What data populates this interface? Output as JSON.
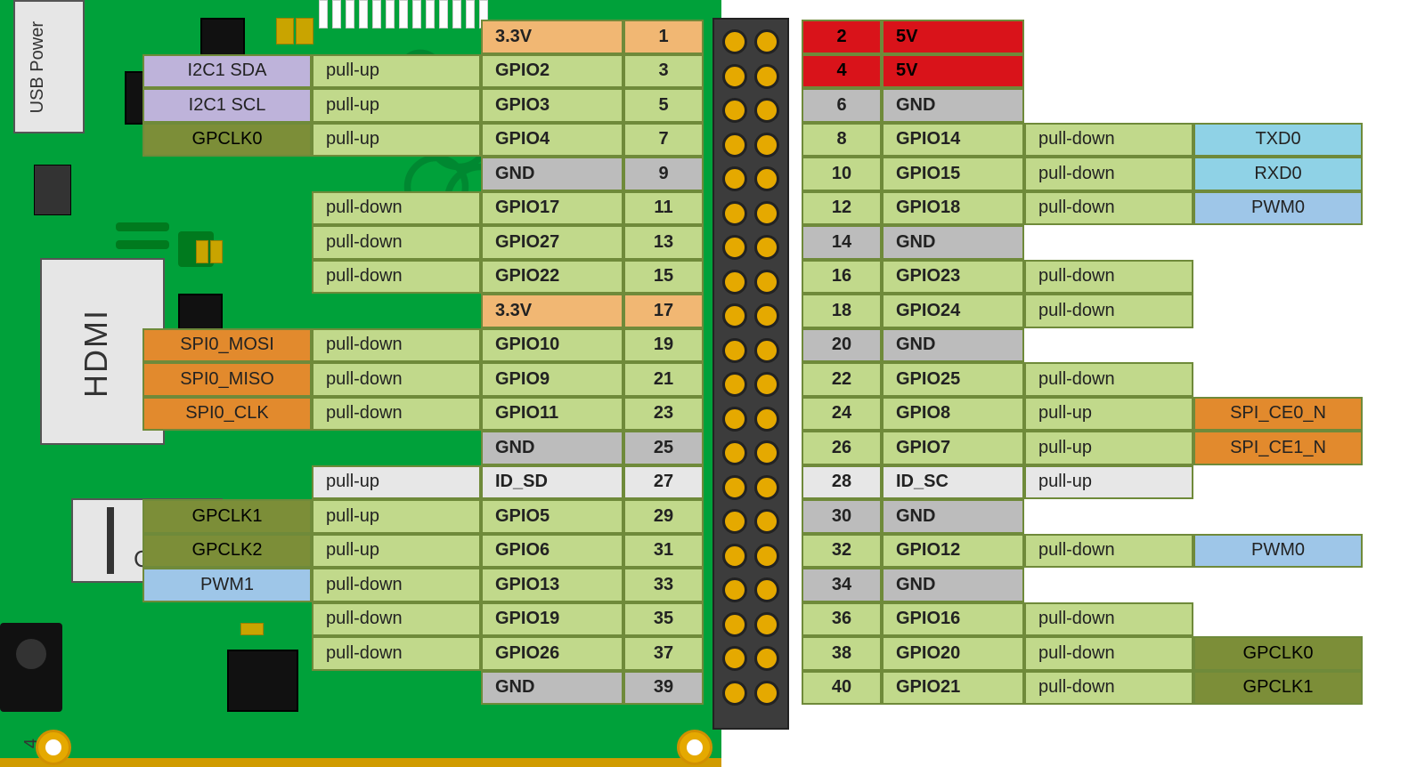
{
  "board": {
    "ports": {
      "usb_power": "USB\nPower",
      "hdmi": "HDMI",
      "camera": "Came"
    },
    "corner_number": "4"
  },
  "colors": {
    "gpio": "#c1d98b",
    "3v3": "#f1b773",
    "5v": "#d9131a",
    "gnd": "#bcbcbc",
    "id": "#e7e7e7",
    "pwm": "#9ec6e8",
    "uart": "#8fd2e6",
    "spi": "#e28a2d",
    "i2c": "#beb3da",
    "clk": "#7c8e38"
  },
  "pins": {
    "left": [
      {
        "num": "1",
        "name": "3.3V",
        "type": "3v3"
      },
      {
        "num": "3",
        "name": "GPIO2",
        "type": "gpio",
        "pull": "pull-up",
        "alt": "I2C1 SDA",
        "altType": "i2c"
      },
      {
        "num": "5",
        "name": "GPIO3",
        "type": "gpio",
        "pull": "pull-up",
        "alt": "I2C1 SCL",
        "altType": "i2c"
      },
      {
        "num": "7",
        "name": "GPIO4",
        "type": "gpio",
        "pull": "pull-up",
        "alt": "GPCLK0",
        "altType": "clk"
      },
      {
        "num": "9",
        "name": "GND",
        "type": "gnd"
      },
      {
        "num": "11",
        "name": "GPIO17",
        "type": "gpio",
        "pull": "pull-down"
      },
      {
        "num": "13",
        "name": "GPIO27",
        "type": "gpio",
        "pull": "pull-down"
      },
      {
        "num": "15",
        "name": "GPIO22",
        "type": "gpio",
        "pull": "pull-down"
      },
      {
        "num": "17",
        "name": "3.3V",
        "type": "3v3"
      },
      {
        "num": "19",
        "name": "GPIO10",
        "type": "gpio",
        "pull": "pull-down",
        "alt": "SPI0_MOSI",
        "altType": "spi"
      },
      {
        "num": "21",
        "name": "GPIO9",
        "type": "gpio",
        "pull": "pull-down",
        "alt": "SPI0_MISO",
        "altType": "spi"
      },
      {
        "num": "23",
        "name": "GPIO11",
        "type": "gpio",
        "pull": "pull-down",
        "alt": "SPI0_CLK",
        "altType": "spi"
      },
      {
        "num": "25",
        "name": "GND",
        "type": "gnd"
      },
      {
        "num": "27",
        "name": "ID_SD",
        "type": "id",
        "pull": "pull-up"
      },
      {
        "num": "29",
        "name": "GPIO5",
        "type": "gpio",
        "pull": "pull-up",
        "alt": "GPCLK1",
        "altType": "clk"
      },
      {
        "num": "31",
        "name": "GPIO6",
        "type": "gpio",
        "pull": "pull-up",
        "alt": "GPCLK2",
        "altType": "clk"
      },
      {
        "num": "33",
        "name": "GPIO13",
        "type": "gpio",
        "pull": "pull-down",
        "alt": "PWM1",
        "altType": "pwm"
      },
      {
        "num": "35",
        "name": "GPIO19",
        "type": "gpio",
        "pull": "pull-down"
      },
      {
        "num": "37",
        "name": "GPIO26",
        "type": "gpio",
        "pull": "pull-down"
      },
      {
        "num": "39",
        "name": "GND",
        "type": "gnd"
      }
    ],
    "right": [
      {
        "num": "2",
        "name": "5V",
        "type": "5v"
      },
      {
        "num": "4",
        "name": "5V",
        "type": "5v"
      },
      {
        "num": "6",
        "name": "GND",
        "type": "gnd"
      },
      {
        "num": "8",
        "name": "GPIO14",
        "type": "gpio",
        "pull": "pull-down",
        "alt": "TXD0",
        "altType": "uart"
      },
      {
        "num": "10",
        "name": "GPIO15",
        "type": "gpio",
        "pull": "pull-down",
        "alt": "RXD0",
        "altType": "uart"
      },
      {
        "num": "12",
        "name": "GPIO18",
        "type": "gpio",
        "pull": "pull-down",
        "alt": "PWM0",
        "altType": "pwm"
      },
      {
        "num": "14",
        "name": "GND",
        "type": "gnd"
      },
      {
        "num": "16",
        "name": "GPIO23",
        "type": "gpio",
        "pull": "pull-down"
      },
      {
        "num": "18",
        "name": "GPIO24",
        "type": "gpio",
        "pull": "pull-down"
      },
      {
        "num": "20",
        "name": "GND",
        "type": "gnd"
      },
      {
        "num": "22",
        "name": "GPIO25",
        "type": "gpio",
        "pull": "pull-down"
      },
      {
        "num": "24",
        "name": "GPIO8",
        "type": "gpio",
        "pull": "pull-up",
        "alt": "SPI_CE0_N",
        "altType": "spi"
      },
      {
        "num": "26",
        "name": "GPIO7",
        "type": "gpio",
        "pull": "pull-up",
        "alt": "SPI_CE1_N",
        "altType": "spi"
      },
      {
        "num": "28",
        "name": "ID_SC",
        "type": "id",
        "pull": "pull-up"
      },
      {
        "num": "30",
        "name": "GND",
        "type": "gnd"
      },
      {
        "num": "32",
        "name": "GPIO12",
        "type": "gpio",
        "pull": "pull-down",
        "alt": "PWM0",
        "altType": "pwm"
      },
      {
        "num": "34",
        "name": "GND",
        "type": "gnd"
      },
      {
        "num": "36",
        "name": "GPIO16",
        "type": "gpio",
        "pull": "pull-down"
      },
      {
        "num": "38",
        "name": "GPIO20",
        "type": "gpio",
        "pull": "pull-down",
        "alt": "GPCLK0",
        "altType": "clk"
      },
      {
        "num": "40",
        "name": "GPIO21",
        "type": "gpio",
        "pull": "pull-down",
        "alt": "GPCLK1",
        "altType": "clk"
      }
    ]
  }
}
